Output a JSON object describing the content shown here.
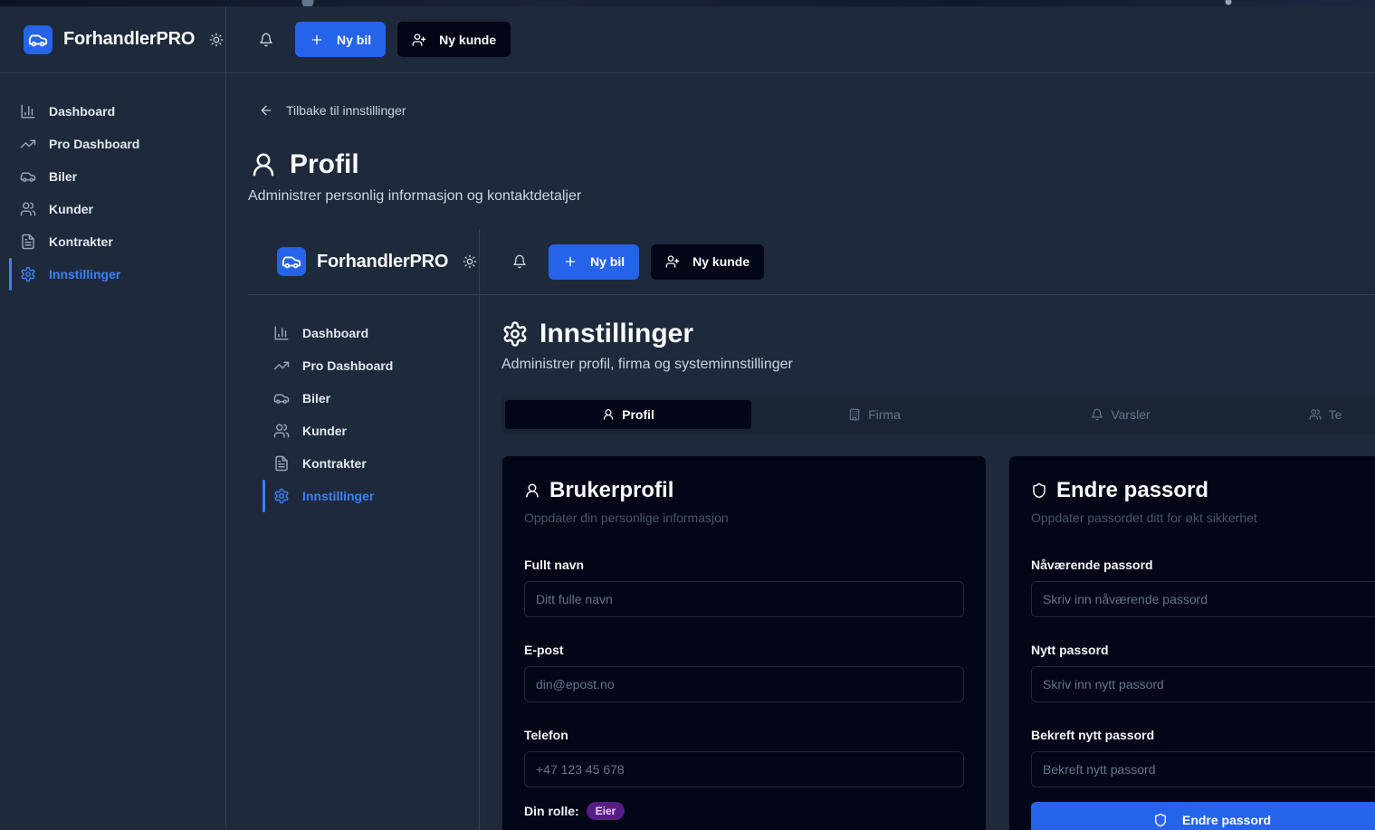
{
  "brand": {
    "name": "ForhandlerPRO"
  },
  "header": {
    "new_car": "Ny bil",
    "new_customer": "Ny kunde"
  },
  "sidebar": {
    "items": [
      {
        "label": "Dashboard"
      },
      {
        "label": "Pro Dashboard"
      },
      {
        "label": "Biler"
      },
      {
        "label": "Kunder"
      },
      {
        "label": "Kontrakter"
      },
      {
        "label": "Innstillinger"
      }
    ],
    "active": "Innstillinger"
  },
  "main": {
    "back_link": "Tilbake til innstillinger",
    "title": "Profil",
    "subtitle": "Administrer personlig informasjon og kontaktdetaljer"
  },
  "inner": {
    "title": "Innstillinger",
    "subtitle": "Administrer profil, firma og systeminnstillinger",
    "tabs": [
      {
        "label": "Profil"
      },
      {
        "label": "Firma"
      },
      {
        "label": "Varsler"
      },
      {
        "label": "Te"
      }
    ],
    "profile_card": {
      "title": "Brukerprofil",
      "subtitle": "Oppdater din personlige informasjon",
      "fields": [
        {
          "label": "Fullt navn",
          "placeholder": "Ditt fulle navn",
          "value": ""
        },
        {
          "label": "E-post",
          "placeholder": "din@epost.no",
          "value": ""
        },
        {
          "label": "Telefon",
          "placeholder": "+47 123 45 678",
          "value": ""
        }
      ],
      "role_label": "Din rolle:",
      "role_badge": "Eier"
    },
    "password_card": {
      "title": "Endre passord",
      "subtitle": "Oppdater passordet ditt for økt sikkerhet",
      "fields": [
        {
          "label": "Nåværende passord",
          "placeholder": "Skriv inn nåværende passord"
        },
        {
          "label": "Nytt passord",
          "placeholder": "Skriv inn nytt passord"
        },
        {
          "label": "Bekreft nytt passord",
          "placeholder": "Bekreft nytt passord"
        }
      ],
      "button": "Endre passord"
    }
  },
  "colors": {
    "accent": "#2563eb",
    "background": "#1e293b",
    "card": "#020617",
    "badge": "#581c87"
  }
}
